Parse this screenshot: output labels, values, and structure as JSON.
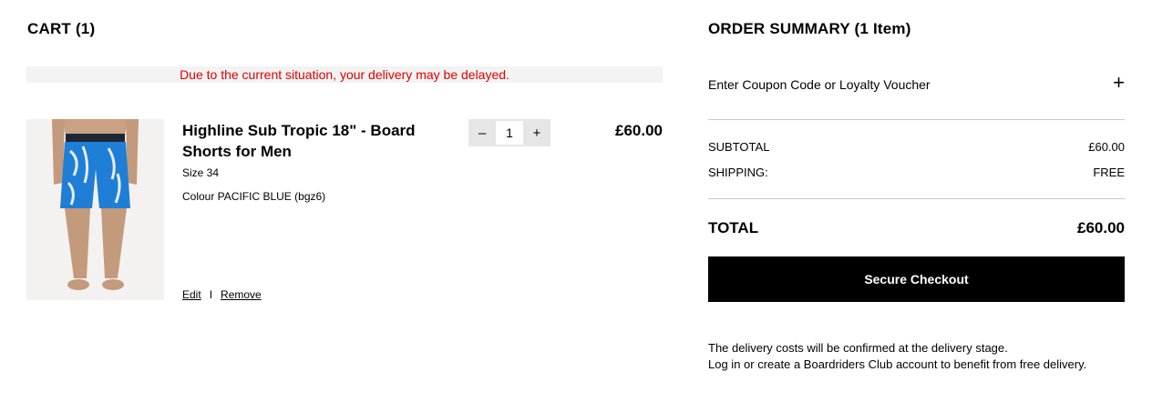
{
  "cart": {
    "title": "CART (1)",
    "notice": "Due to the current situation, your delivery may be delayed."
  },
  "item": {
    "name": "Highline Sub Tropic 18\" - Board Shorts for Men",
    "size": "Size 34",
    "colour": "Colour PACIFIC BLUE (bgz6)",
    "quantity": "1",
    "qty_minus": "–",
    "qty_plus": "+",
    "price": "£60.00",
    "edit_label": "Edit",
    "separator": "I",
    "remove_label": "Remove",
    "image_icon": "board-shorts-photo"
  },
  "summary": {
    "title": "ORDER SUMMARY (1 Item)",
    "coupon_label": "Enter Coupon Code or Loyalty Voucher",
    "coupon_toggle": "+",
    "subtotal_label": "SUBTOTAL",
    "subtotal_value": "£60.00",
    "shipping_label": "SHIPPING:",
    "shipping_value": "FREE",
    "total_label": "TOTAL",
    "total_value": "£60.00",
    "checkout_label": "Secure Checkout",
    "info_line1": "The delivery costs will be confirmed at the delivery stage.",
    "info_line2": "Log in or create a Boardriders Club account to benefit from free delivery."
  },
  "colors": {
    "notice_text": "#e00000",
    "notice_bg": "#f3f3f3",
    "checkout_bg": "#000000",
    "shorts_primary": "#1f7fd6"
  }
}
